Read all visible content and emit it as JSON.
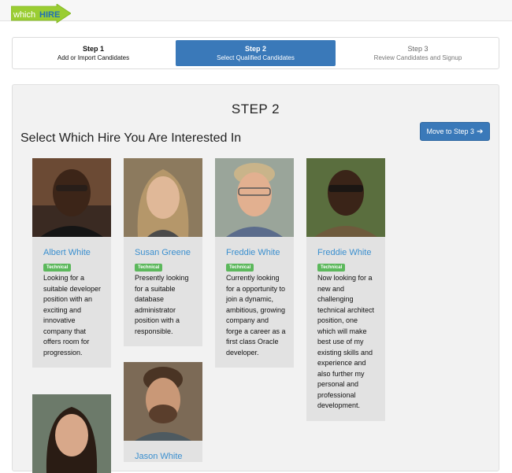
{
  "brand": {
    "logo_part1": "which",
    "logo_part2": "HIRE"
  },
  "steps": [
    {
      "title": "Step 1",
      "desc": "Add or Import Candidates"
    },
    {
      "title": "Step 2",
      "desc": "Select Qualified Candidates"
    },
    {
      "title": "Step 3",
      "desc": "Review Candidates and Signup"
    }
  ],
  "main": {
    "heading": "STEP 2",
    "subtitle": "Select Which Hire You Are Interested In",
    "move_button": "Move to Step 3"
  },
  "candidates": [
    {
      "name": "Albert White",
      "tag": "Technical",
      "desc": "Looking for a suitable developer position with an exciting and innovative company that offers room for progression."
    },
    {
      "name": "Susan Greene",
      "tag": "Technical",
      "desc": "Presently looking for a suitable database administrator position with a responsible."
    },
    {
      "name": "Freddie White",
      "tag": "Technical",
      "desc": "Currently looking for a opportunity to join a dynamic, ambitious, growing company and forge a career as a first class Oracle developer."
    },
    {
      "name": "Freddie White",
      "tag": "Technical",
      "desc": "Now looking for a new and challenging technical architect position, one which will make best use of my existing skills and experience and also further my personal and professional development."
    },
    {
      "name": "Jason White"
    }
  ],
  "colors": {
    "accent": "#3a79b9",
    "link": "#3a8fcf",
    "badge": "#5cb85c",
    "logo_green": "#9acd32"
  }
}
